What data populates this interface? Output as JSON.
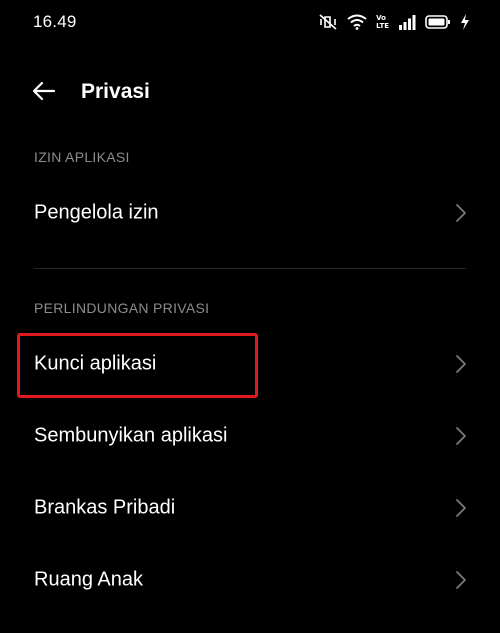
{
  "status_bar": {
    "time": "16.49",
    "icons": [
      "mute-vibrate-icon",
      "wifi-icon",
      "volte-icon",
      "signal-icon",
      "battery-icon",
      "charging-icon"
    ],
    "volte_top": "Vo",
    "volte_bottom": "LTE"
  },
  "header": {
    "back_icon": "arrow-left-icon",
    "title": "Privasi"
  },
  "sections": [
    {
      "title": "IZIN APLIKASI",
      "items": [
        {
          "label": "Pengelola izin"
        }
      ]
    },
    {
      "title": "PERLINDUNGAN PRIVASI",
      "items": [
        {
          "label": "Kunci aplikasi"
        },
        {
          "label": "Sembunyikan aplikasi"
        },
        {
          "label": "Brankas Pribadi"
        },
        {
          "label": "Ruang Anak"
        }
      ]
    }
  ],
  "colors": {
    "background": "#000000",
    "text": "#ffffff",
    "section_header": "#8c8c8c",
    "chevron": "#7a7a7a",
    "divider": "#262626",
    "highlight": "#e0191e"
  }
}
